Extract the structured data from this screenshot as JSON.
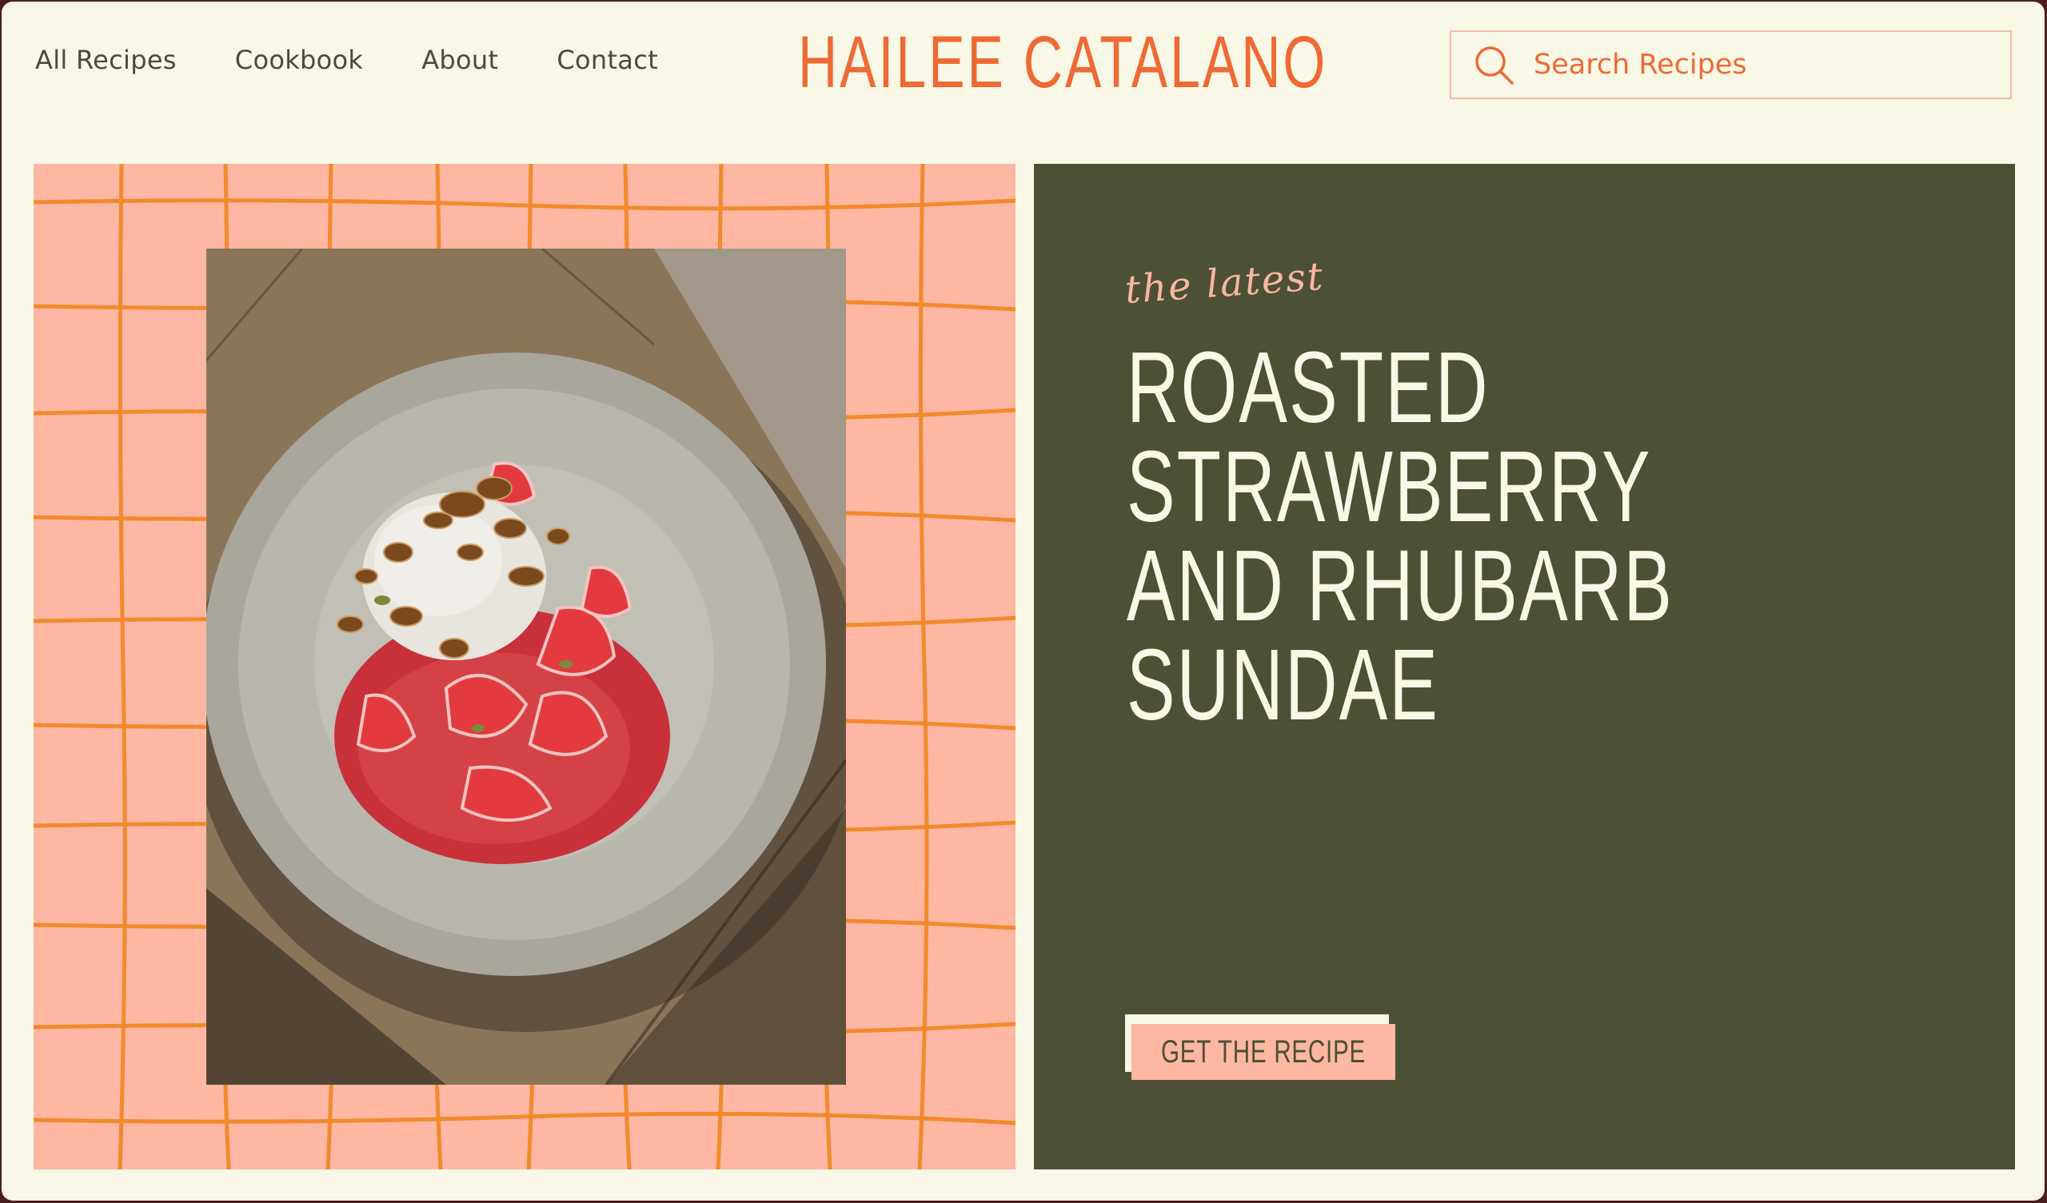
{
  "nav": {
    "items": [
      {
        "label": "All Recipes"
      },
      {
        "label": "Cookbook"
      },
      {
        "label": "About"
      },
      {
        "label": "Contact"
      }
    ]
  },
  "site": {
    "title": "HAILEE CATALANO"
  },
  "search": {
    "placeholder": "Search Recipes",
    "icon": "search-icon"
  },
  "hero": {
    "eyebrow": "the latest",
    "title": "ROASTED STRAWBERRY AND RHUBARB SUNDAE",
    "cta_label": "GET THE RECIPE"
  },
  "colors": {
    "background": "#f9f7e6",
    "accent": "#ee6a35",
    "panel_pink": "#fdb7a2",
    "grid_orange": "#f18a2b",
    "panel_green": "#4c5035"
  }
}
